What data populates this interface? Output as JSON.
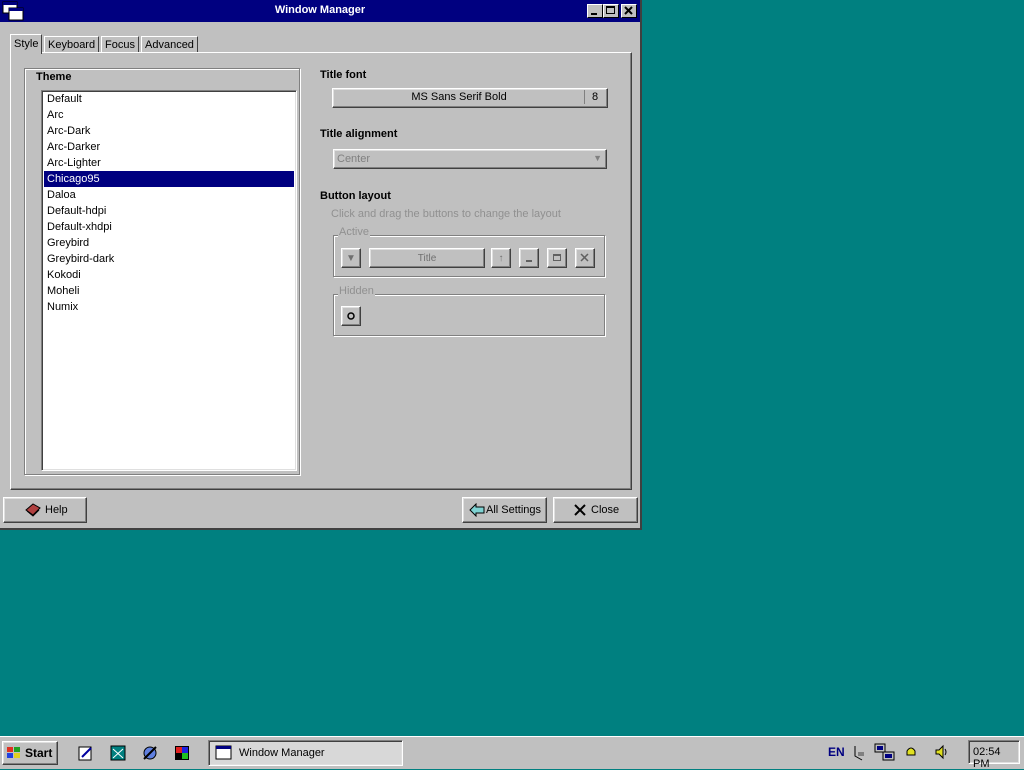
{
  "window": {
    "title": "Window Manager",
    "tabs": [
      {
        "label": "Style",
        "active": true
      },
      {
        "label": "Keyboard"
      },
      {
        "label": "Focus"
      },
      {
        "label": "Advanced"
      }
    ]
  },
  "theme": {
    "label": "Theme",
    "items": [
      "Default",
      "Arc",
      "Arc-Dark",
      "Arc-Darker",
      "Arc-Lighter",
      "Chicago95",
      "Daloa",
      "Default-hdpi",
      "Default-xhdpi",
      "Greybird",
      "Greybird-dark",
      "Kokodi",
      "Moheli",
      "Numix"
    ],
    "selected": "Chicago95"
  },
  "title_font": {
    "label": "Title font",
    "name": "MS Sans Serif Bold",
    "size": "8"
  },
  "title_alignment": {
    "label": "Title alignment",
    "value": "Center"
  },
  "button_layout": {
    "label": "Button layout",
    "hint": "Click and drag the buttons to change the layout",
    "active_label": "Active",
    "title_button": "Title",
    "hidden_label": "Hidden"
  },
  "buttons": {
    "help": "Help",
    "all_settings": "All Settings",
    "close": "Close"
  },
  "taskbar": {
    "start": "Start",
    "task_title": "Window Manager",
    "language": "EN",
    "clock": "02:54 PM"
  },
  "colors": {
    "desktop": "#008080",
    "titlebar": "#000080",
    "face": "#c0c0c0",
    "selection": "#000080"
  }
}
